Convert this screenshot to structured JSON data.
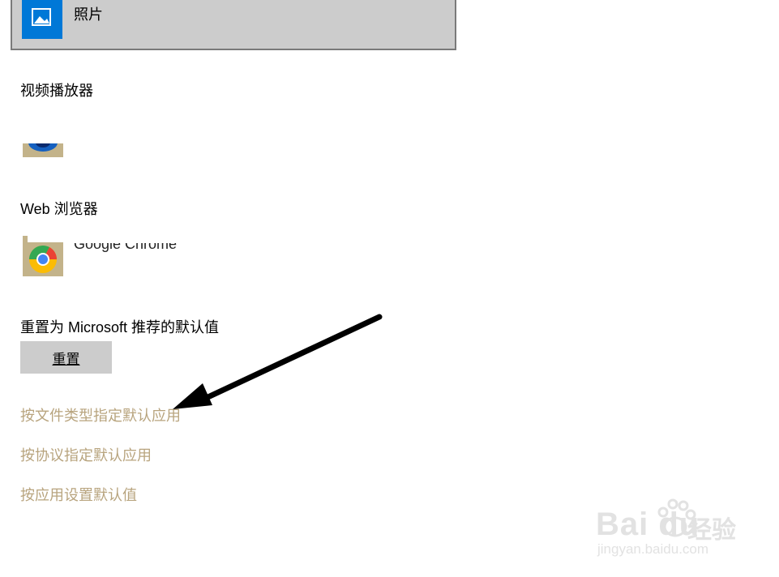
{
  "photos": {
    "label": "照片"
  },
  "video_player": {
    "heading": "视频播放器"
  },
  "web_browser": {
    "heading": "Web 浏览器",
    "app_name": "Google Chrome"
  },
  "reset": {
    "heading": "重置为 Microsoft 推荐的默认值",
    "button_label": "重置"
  },
  "links": [
    {
      "label": "按文件类型指定默认应用"
    },
    {
      "label": "按协议指定默认应用"
    },
    {
      "label": "按应用设置默认值"
    }
  ],
  "watermark": {
    "logo": "Bai du",
    "brand": "经验",
    "url": "jingyan.baidu.com"
  },
  "colors": {
    "link": "#b8a47e",
    "tile_selected": "#cccccc",
    "photos_blue": "#0078d7",
    "arrow": "#000000"
  }
}
